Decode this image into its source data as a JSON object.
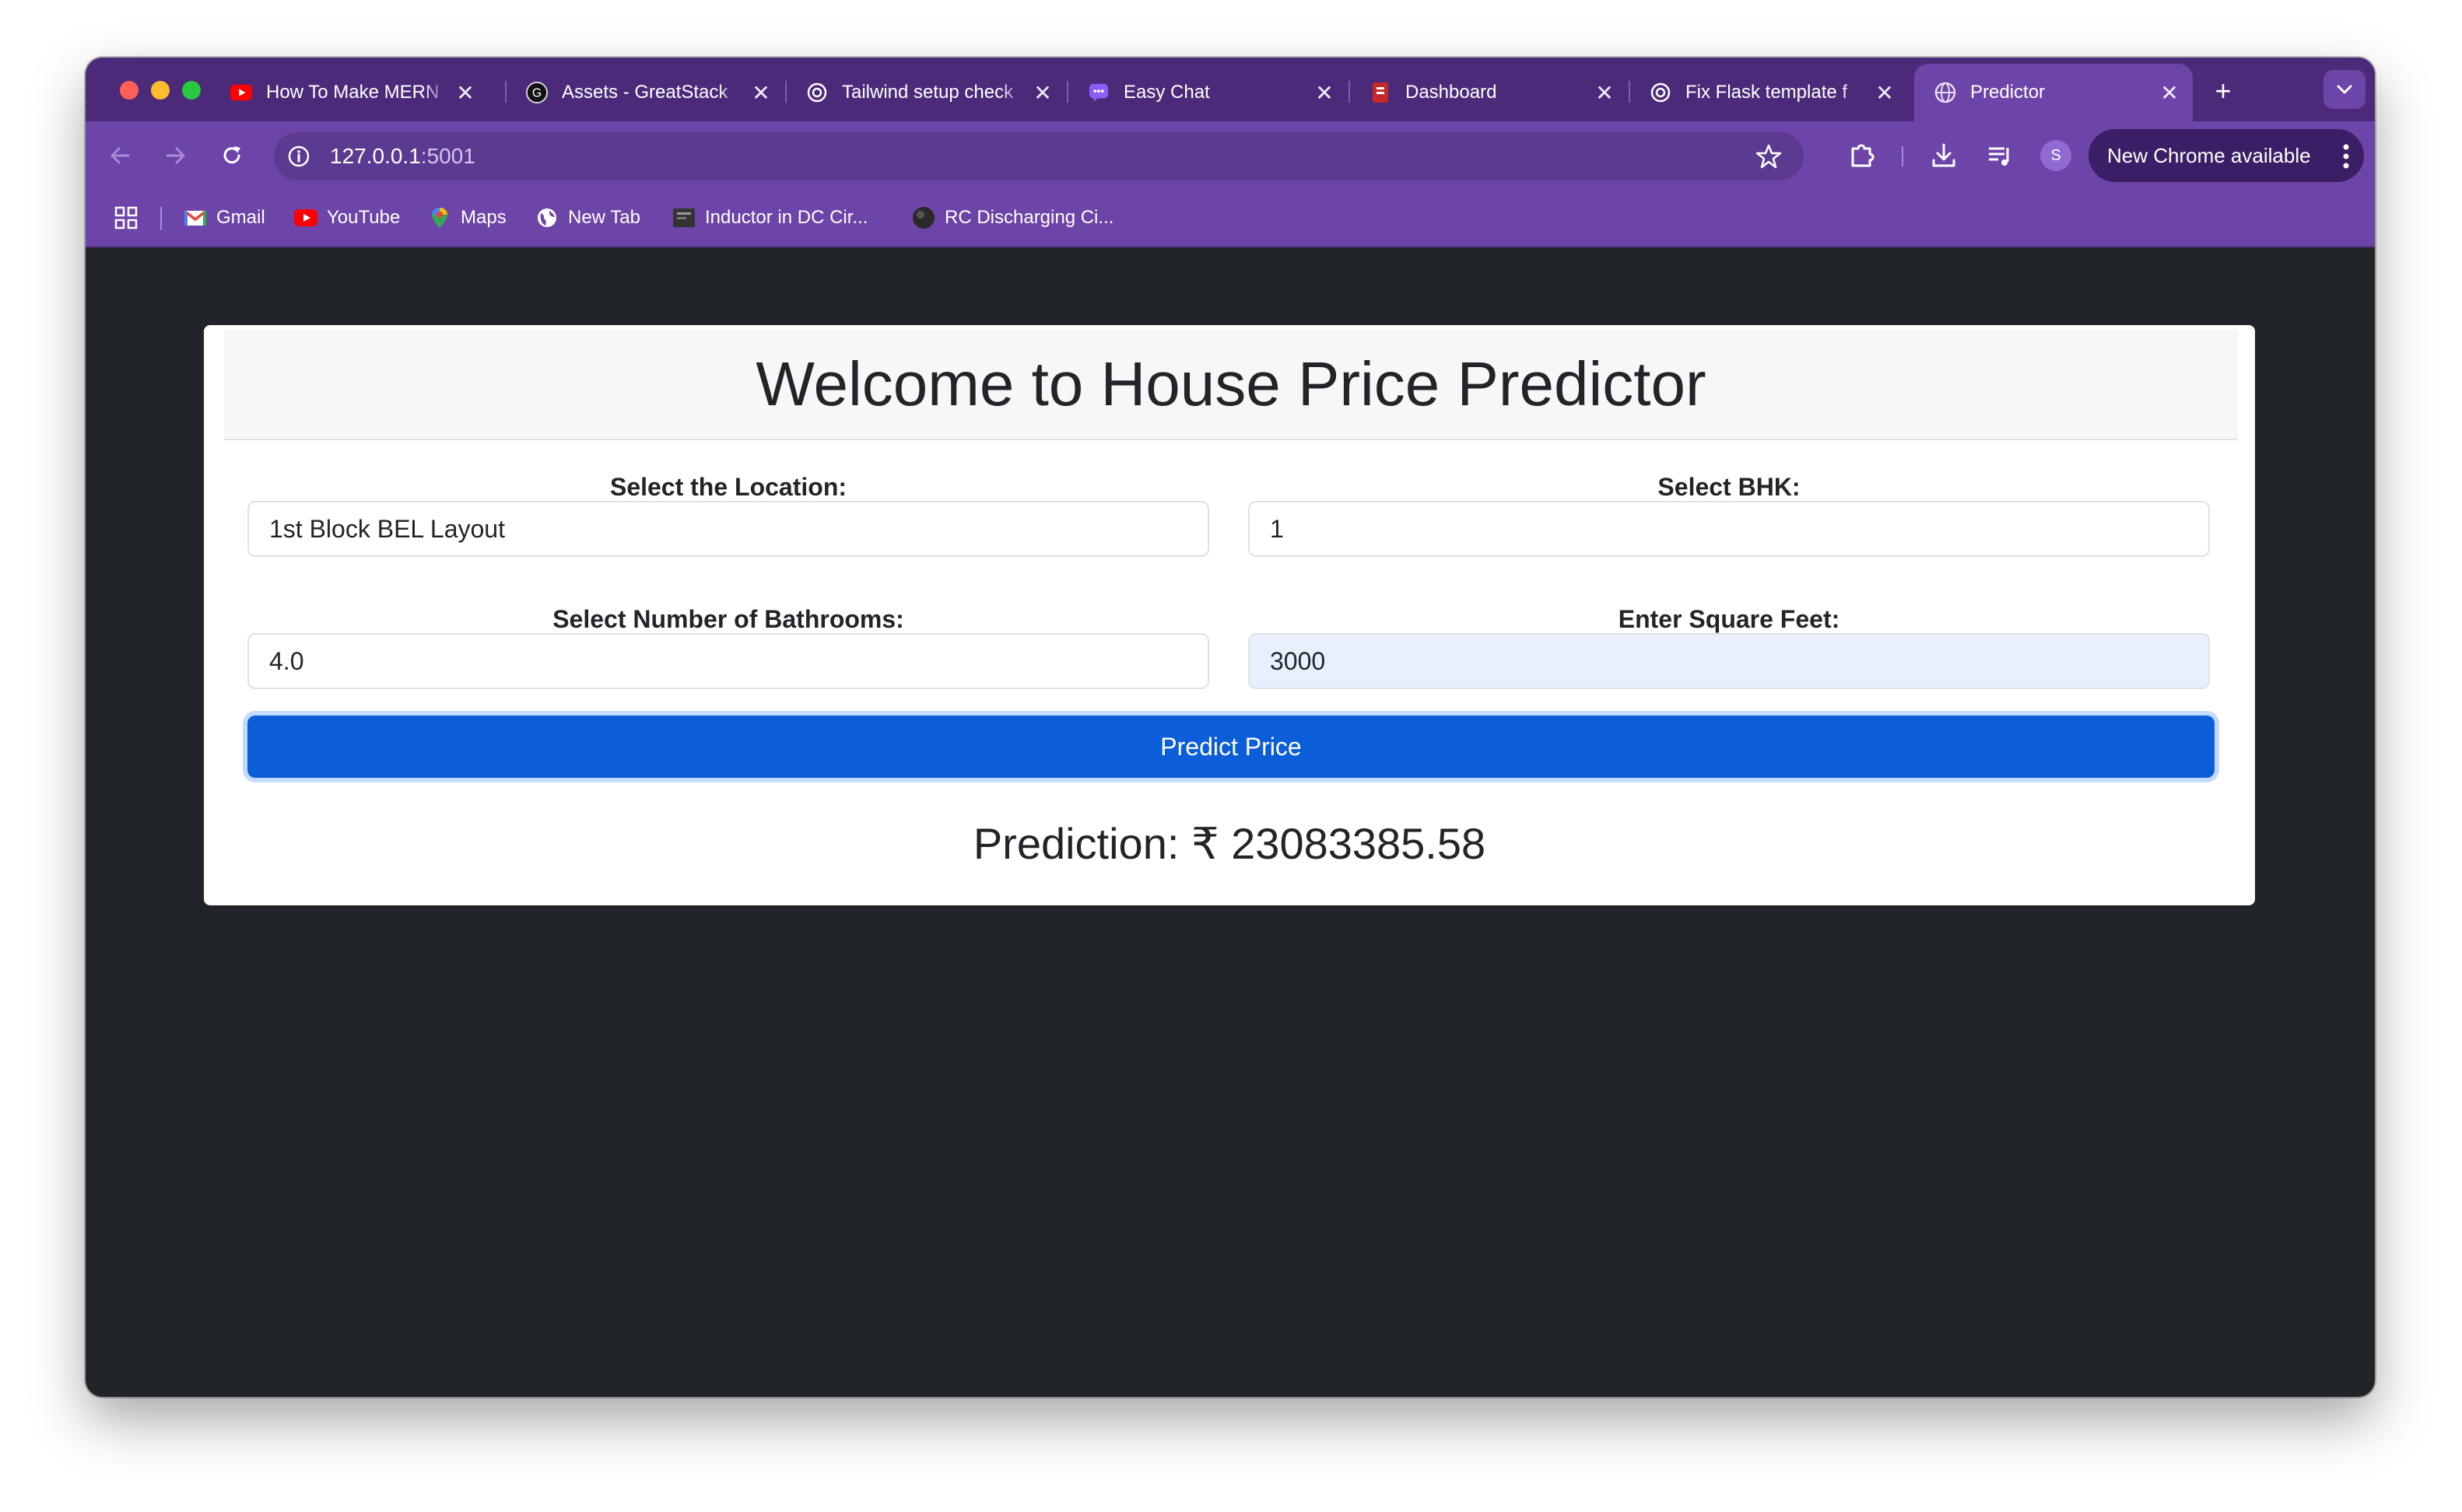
{
  "browser": {
    "tabs": [
      {
        "title": "How To Make MERN",
        "icon": "youtube-icon"
      },
      {
        "title": "Assets - GreatStack",
        "icon": "greatstack-icon"
      },
      {
        "title": "Tailwind setup check",
        "icon": "openai-icon"
      },
      {
        "title": "Easy Chat",
        "icon": "chat-icon"
      },
      {
        "title": "Dashboard",
        "icon": "dashboard-icon"
      },
      {
        "title": "Fix Flask template f",
        "icon": "openai-icon"
      },
      {
        "title": "Predictor",
        "icon": "globe-icon"
      }
    ],
    "address": {
      "host": "127.0.0.1",
      "port": ":5001"
    },
    "update_label": "New Chrome available",
    "profile_initial": "S",
    "bookmarks": [
      {
        "label": "Gmail",
        "icon": "gmail-icon"
      },
      {
        "label": "YouTube",
        "icon": "youtube-icon"
      },
      {
        "label": "Maps",
        "icon": "maps-icon"
      },
      {
        "label": "New Tab",
        "icon": "globe-icon"
      },
      {
        "label": "Inductor in DC Cir...",
        "icon": "video-thumb-icon"
      },
      {
        "label": "RC Discharging Ci...",
        "icon": "video-thumb-icon"
      }
    ]
  },
  "page": {
    "title": "Welcome to House Price Predictor",
    "location": {
      "label": "Select the Location:",
      "value": "1st Block BEL Layout"
    },
    "bhk": {
      "label": "Select BHK:",
      "value": "1"
    },
    "bathrooms": {
      "label": "Select Number of Bathrooms:",
      "value": "4.0"
    },
    "sqft": {
      "label": "Enter Square Feet:",
      "value": "3000"
    },
    "button_label": "Predict Price",
    "prediction": "Prediction: ₹ 23083385.58"
  },
  "colors": {
    "tab_strip": "#4b2a7a",
    "toolbar": "#6d44a7",
    "page_background": "#212529",
    "primary_button": "#0b5ed7"
  }
}
